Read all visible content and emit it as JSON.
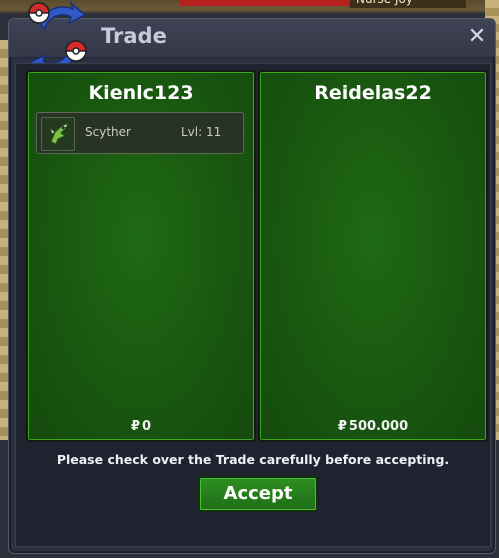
{
  "background": {
    "npc_label": "Nurse Joy"
  },
  "window": {
    "title": "Trade",
    "close_symbol": "✕",
    "logo_icon": "trade-logo-icon"
  },
  "left_panel": {
    "player_name": "Kienlc123",
    "items": [
      {
        "name": "Scyther",
        "level_label": "Lvl: 11",
        "icon": "scyther-icon"
      }
    ],
    "money_symbol": "₽",
    "money": "0"
  },
  "right_panel": {
    "player_name": "Reidelas22",
    "items": [],
    "money_symbol": "₽",
    "money": "500.000"
  },
  "footer": {
    "notice": "Please check over the Trade carefully before accepting.",
    "accept_label": "Accept"
  },
  "colors": {
    "panel_green": "#1a5a10",
    "button_green": "#2e8f22",
    "window_bg": "#2c3040"
  }
}
